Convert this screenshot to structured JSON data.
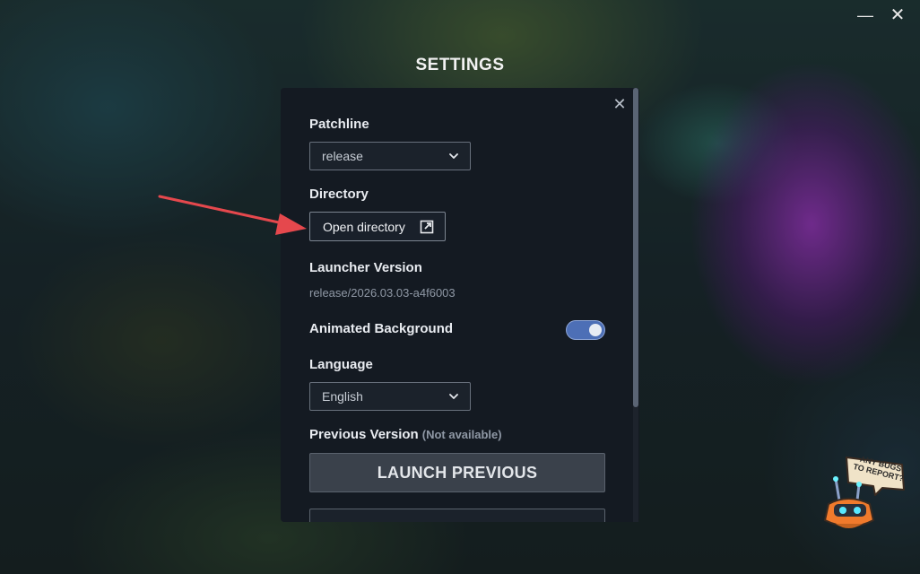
{
  "window": {
    "title": "SETTINGS",
    "minimize_glyph": "—",
    "close_glyph": "✕"
  },
  "panel": {
    "close_glyph": "✕",
    "patchline": {
      "label": "Patchline",
      "value": "release"
    },
    "directory": {
      "label": "Directory",
      "button_label": "Open directory"
    },
    "launcher_version": {
      "label": "Launcher Version",
      "value": "release/2026.03.03-a4f6003"
    },
    "animated_background": {
      "label": "Animated Background",
      "enabled": true
    },
    "language": {
      "label": "Language",
      "value": "English"
    },
    "previous_version": {
      "label": "Previous Version",
      "note": "(Not available)",
      "button_label": "LAUNCH PREVIOUS"
    }
  },
  "bug_report": {
    "text": "ANY BUGS TO REPORT?"
  },
  "colors": {
    "panel_bg": "#141a22",
    "accent_toggle": "#4d6fb6",
    "arrow": "#e5484d"
  },
  "icons": [
    "chevron-down-icon",
    "external-link-icon",
    "close-icon",
    "minimize-icon",
    "bug-mascot-icon",
    "annotation-arrow"
  ]
}
